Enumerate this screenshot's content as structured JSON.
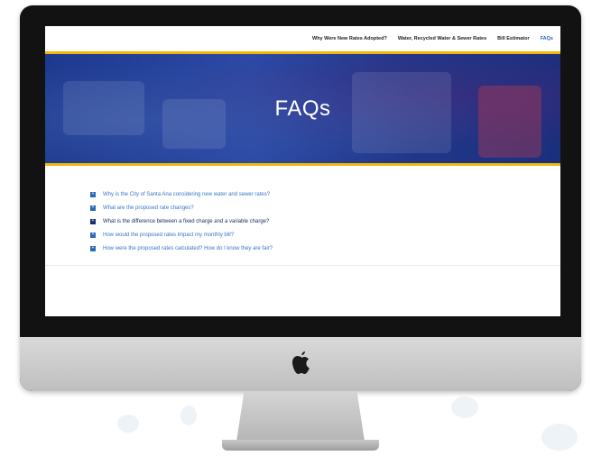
{
  "nav": {
    "items": [
      {
        "label": "Why Were New Rates Adopted?",
        "active": false
      },
      {
        "label": "Water, Recycled Water & Sewer Rates",
        "active": false
      },
      {
        "label": "Bill Estimator",
        "active": false
      },
      {
        "label": "FAQs",
        "active": true
      }
    ]
  },
  "hero": {
    "title": "FAQs"
  },
  "faq": {
    "items": [
      {
        "question": "Why is the City of Santa Ana considering new water and sewer rates?"
      },
      {
        "question": "What are the proposed rate changes?"
      },
      {
        "question": "What is the difference between a fixed charge and a variable charge?"
      },
      {
        "question": "How would the proposed rates impact my monthly bill?"
      },
      {
        "question": "How were the proposed rates calculated? How do I know they are fair?"
      }
    ]
  },
  "colors": {
    "accent": "#2a69b5",
    "hero_blue": "#2c4aa6",
    "hero_border": "#f2b705",
    "dark_text": "#1c2f6b"
  },
  "icons": {
    "faq_marker": "plus-square-icon",
    "device_logo": "apple-logo-icon"
  }
}
